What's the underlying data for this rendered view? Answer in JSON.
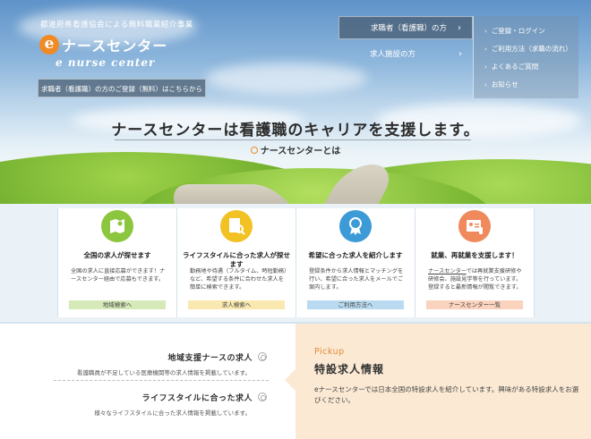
{
  "header": {
    "tagline": "都道府県看護協会による無料職業紹介事業",
    "logo_letter": "e",
    "logo_text": "ナースセンター",
    "logo_subtitle": "e nurse center",
    "register_button": "求職者（看護職）の方のご登録（無料）はこちらから"
  },
  "nav": {
    "tabs": [
      {
        "label": "求職者（看護職）の方"
      },
      {
        "label": "求人施設の方"
      }
    ],
    "side_menu": [
      {
        "label": "ご登録・ログイン"
      },
      {
        "label": "ご利用方法（求職の流れ）"
      },
      {
        "label": "よくあるご質問"
      },
      {
        "label": "お知らせ"
      }
    ]
  },
  "hero": {
    "headline": "ナースセンターは看護職のキャリアを支援します。",
    "about_link": "ナースセンターとは"
  },
  "features": [
    {
      "title": "全国の求人が探せます",
      "desc": "全国の求人に直接応募ができます！ナースセンター経由で応募もできます。",
      "button": "地域検索へ",
      "color": "#8cc63f",
      "btn_bg": "#d6e9b8",
      "icon": "map-icon"
    },
    {
      "title": "ライフスタイルに合った求人が探せます",
      "desc": "勤務地や待遇（フルタイム、時短勤務）など、希望する条件に合わせた求人を簡単に検索できます。",
      "button": "求人検索へ",
      "color": "#f2c124",
      "btn_bg": "#f9e8b0",
      "icon": "search-document-icon"
    },
    {
      "title": "希望に合った求人を紹介します",
      "desc": "登録条件から求人情報とマッチングを行い、希望に合った求人をメールでご案内します。",
      "button": "ご利用方法へ",
      "color": "#3c9bd6",
      "btn_bg": "#b9daf0",
      "icon": "badge-icon"
    },
    {
      "title": "就業、再就業を支援します！",
      "desc_link": "ナースセンター",
      "desc": "では再就業支援研修や研修会、施設見学等を行っています。登録すると最新情報が閲覧できます。",
      "button": "ナースセンター一覧",
      "color": "#f08a5d",
      "btn_bg": "#f9d3bd",
      "icon": "id-card-icon"
    }
  ],
  "jobs": [
    {
      "title": "地域支援ナースの求人",
      "desc": "看護職員が不足している医療機関等の求人情報を掲載しています。"
    },
    {
      "title": "ライフスタイルに合った求人",
      "desc": "様々なライフスタイルに合った求人情報を掲載しています。"
    }
  ],
  "pickup": {
    "label": "Pickup",
    "title": "特設求人情報",
    "desc": "eナースセンターでは日本全国の特設求人を紹介しています。興味がある特設求人をお選びください。"
  }
}
